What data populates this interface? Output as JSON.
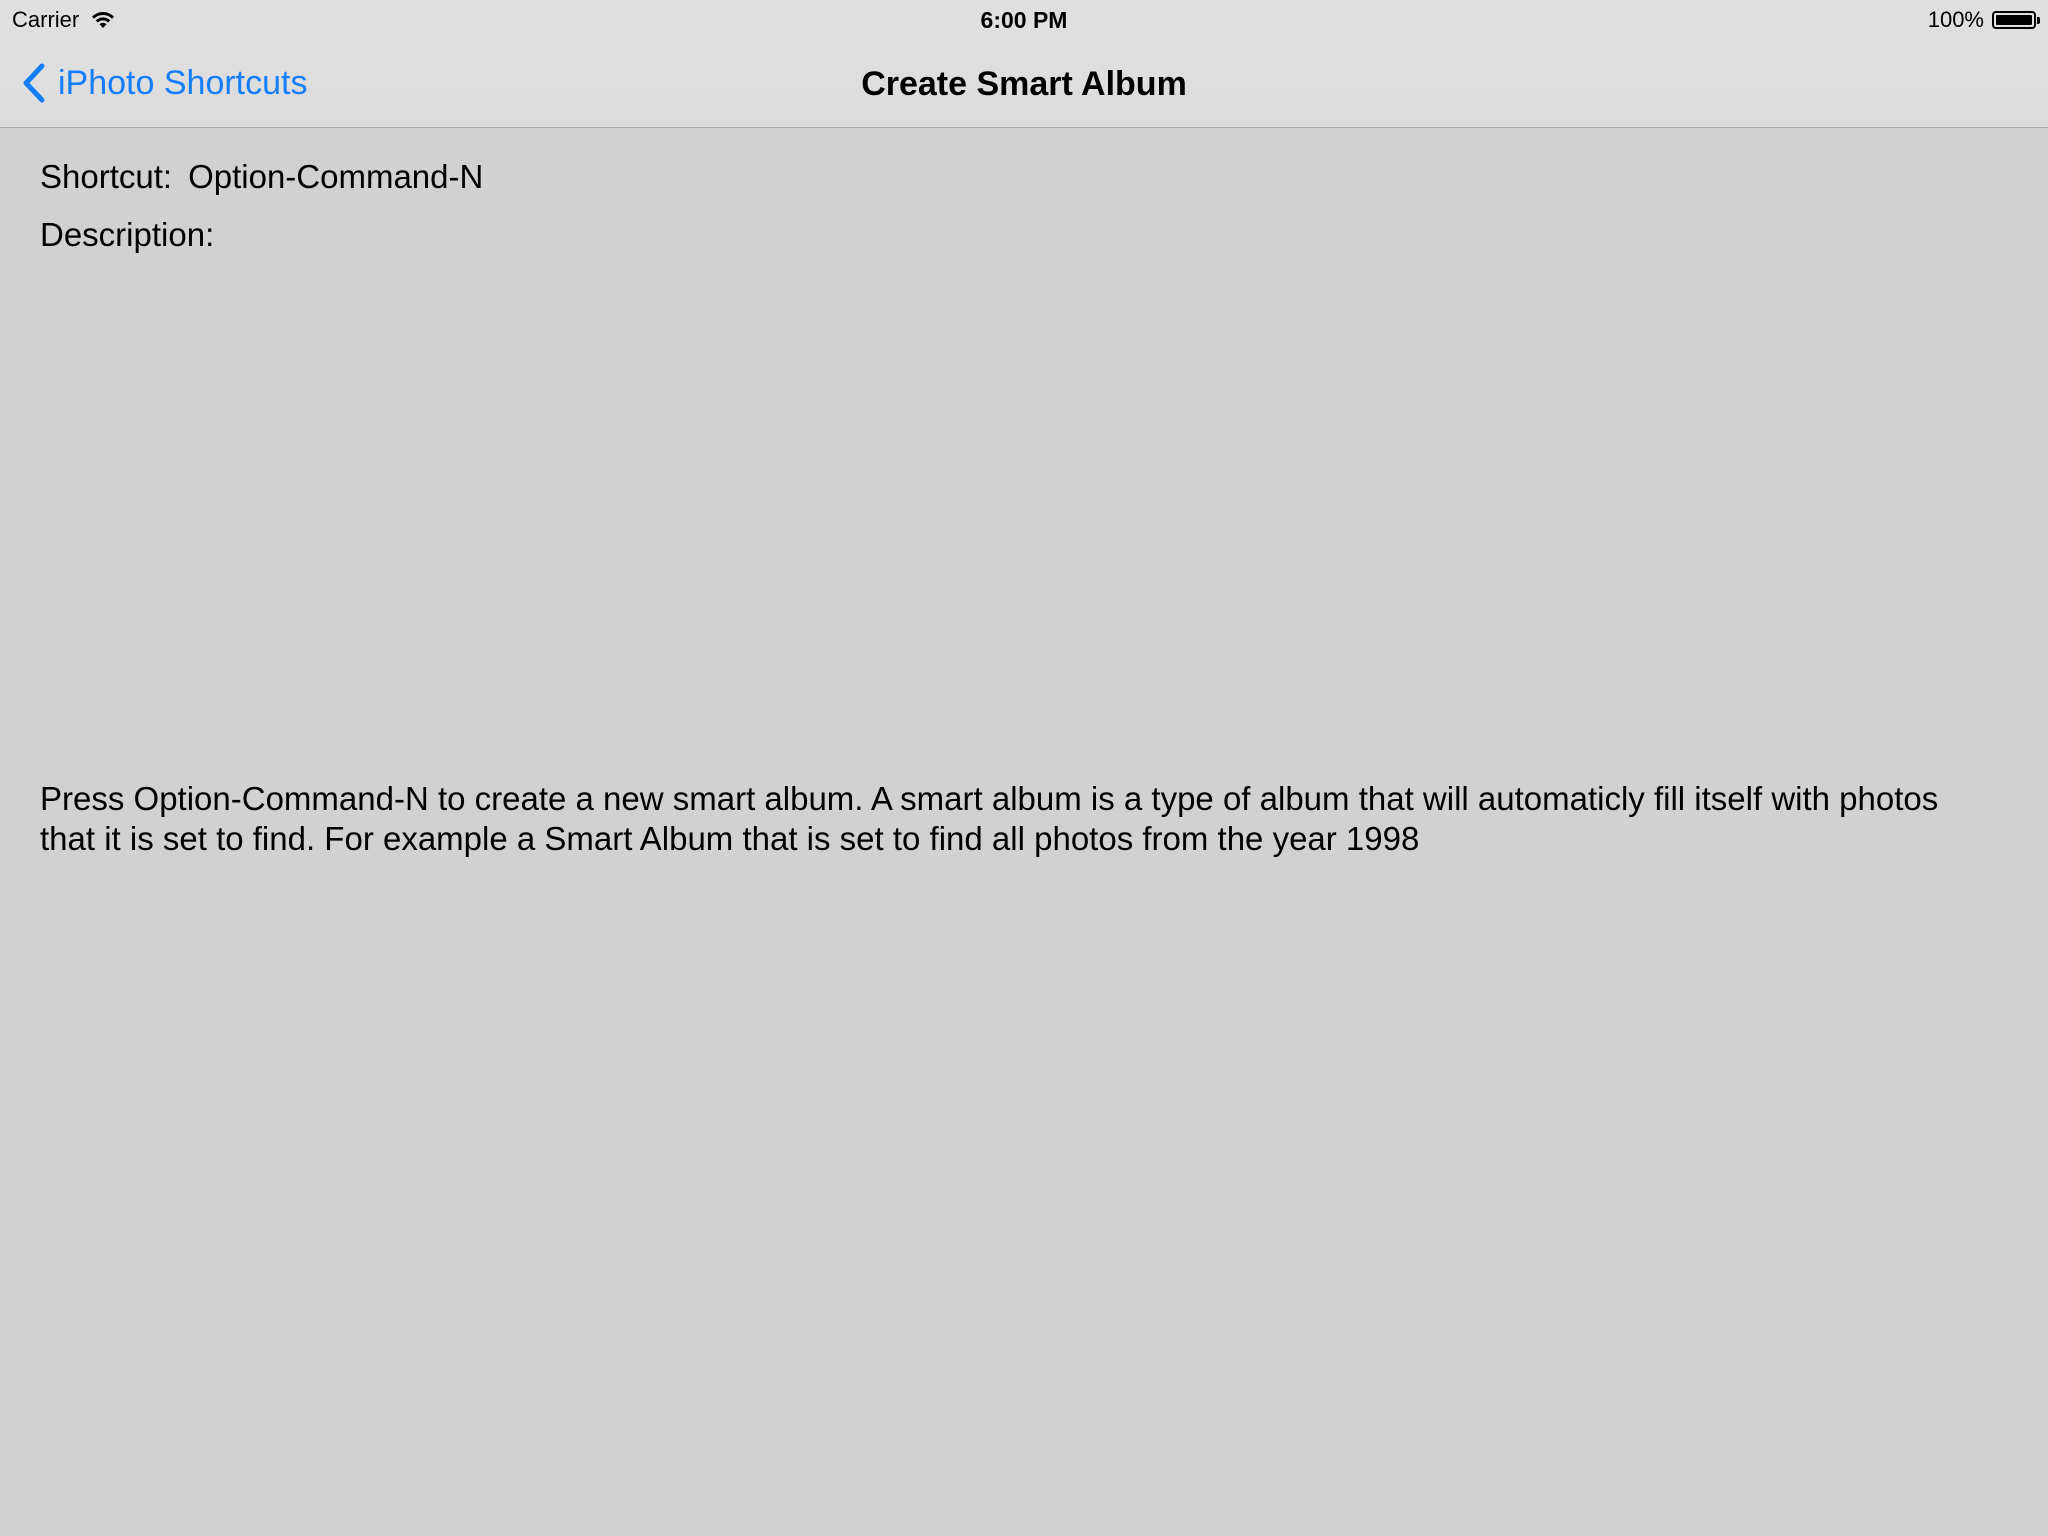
{
  "status_bar": {
    "carrier": "Carrier",
    "time": "6:00 PM",
    "battery_percent": "100%",
    "battery_level": 1.0,
    "wifi_icon": "wifi-icon",
    "battery_icon": "battery-icon"
  },
  "nav_bar": {
    "back_label": "iPhoto Shortcuts",
    "back_icon": "chevron-left-icon",
    "title": "Create Smart Album",
    "accent_color": "#157efb"
  },
  "detail": {
    "shortcut_label": "Shortcut:",
    "shortcut_value": "Option-Command-N",
    "description_label": "Description:",
    "description_text": "Press Option-Command-N to create a new smart album. A smart album is a type of album that will automaticly fill itself with photos that it is set to find. For example a Smart Album that is set to find all photos from the year 1998"
  },
  "colors": {
    "background": "#d1d1d1",
    "bar_background": "#dfdfdf"
  }
}
